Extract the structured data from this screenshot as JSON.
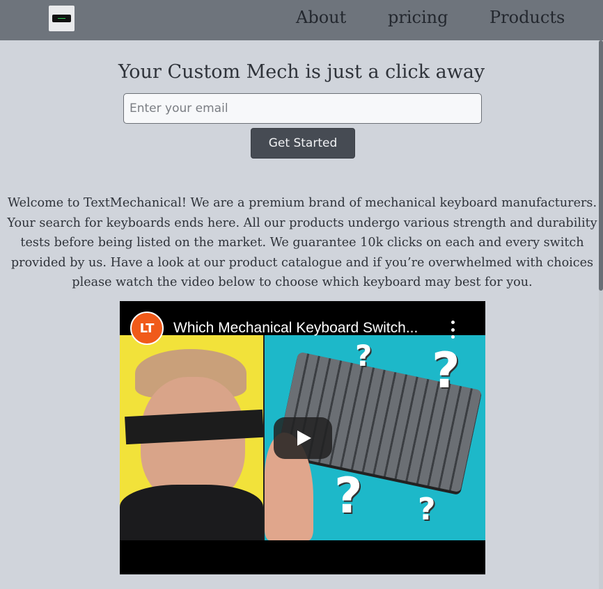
{
  "nav": {
    "links": [
      "About",
      "pricing",
      "Products"
    ]
  },
  "hero": {
    "title": "Your Custom Mech is just a click away",
    "email_placeholder": "Enter your email",
    "cta_label": "Get Started"
  },
  "welcome": {
    "text": "Welcome to TextMechanical! We are a premium brand of mechanical keyboard manufacturers. Your search for keyboards ends here. All our products undergo various strength and durability tests before being listed on the market. We guarantee 10k clicks on each and every switch provided by us. Have a look at our product catalogue and if you’re overwhelmed with choices please watch the video below to choose which keyboard may best for you."
  },
  "video": {
    "title": "Which Mechanical Keyboard Switch..."
  },
  "colors": {
    "background": "#d0d4db",
    "navbar": "#6e747c",
    "button": "#464b53"
  },
  "icons": {
    "logo": "keyboard-logo-icon",
    "menu": "kebab-menu-icon",
    "play": "play-icon",
    "channel": "channel-avatar-icon"
  }
}
